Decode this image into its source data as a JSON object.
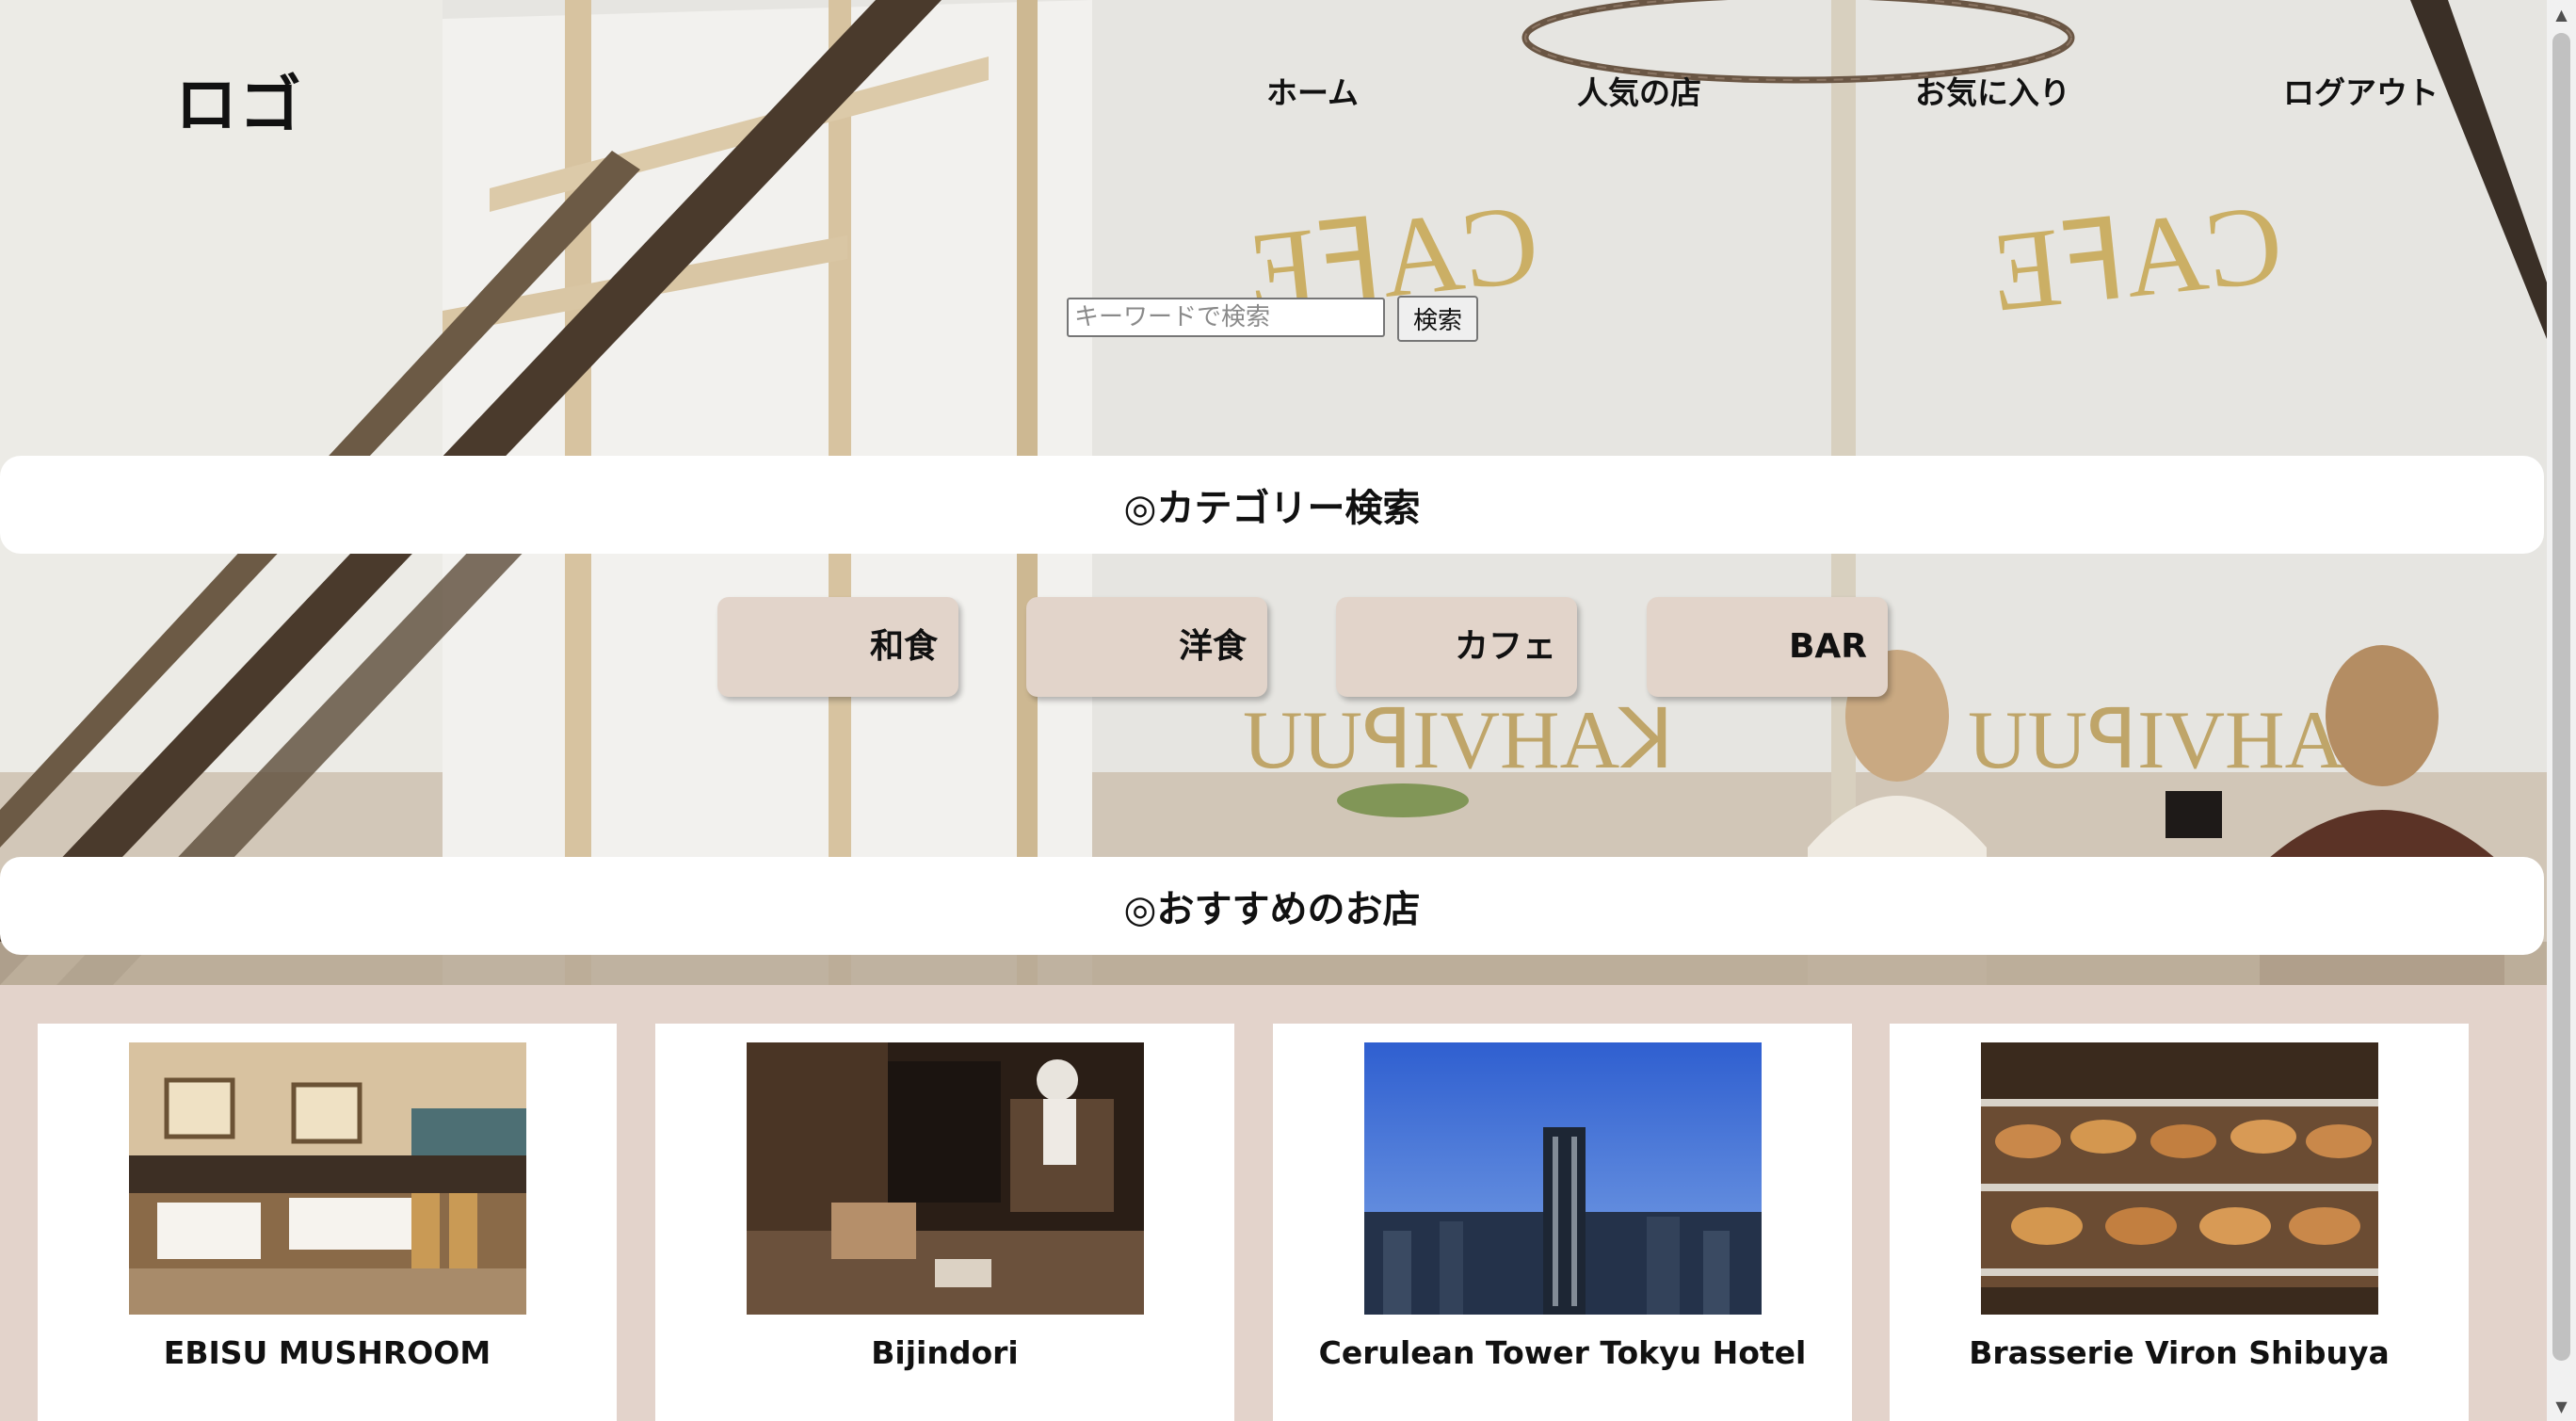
{
  "header": {
    "logo": "ロゴ",
    "nav": {
      "home": "ホーム",
      "popular": "人気の店",
      "favorites": "お気に入り",
      "logout": "ログアウト"
    }
  },
  "search": {
    "placeholder": "キーワードで検索",
    "button_label": "検索"
  },
  "category_section": {
    "title": "◎カテゴリー検索",
    "items": [
      {
        "label": "和食"
      },
      {
        "label": "洋食"
      },
      {
        "label": "カフェ"
      },
      {
        "label": "BAR"
      }
    ]
  },
  "recommend_section": {
    "title": "◎おすすめのお店"
  },
  "shops": [
    {
      "name": "EBISU MUSHROOM"
    },
    {
      "name": "Bijindori"
    },
    {
      "name": "Cerulean Tower Tokyu Hotel"
    },
    {
      "name": "Brasserie Viron Shibuya"
    }
  ],
  "colors": {
    "accent_beige": "#e2d4ca",
    "shop_area_bg": "#e3d3cb",
    "text": "#111111"
  }
}
